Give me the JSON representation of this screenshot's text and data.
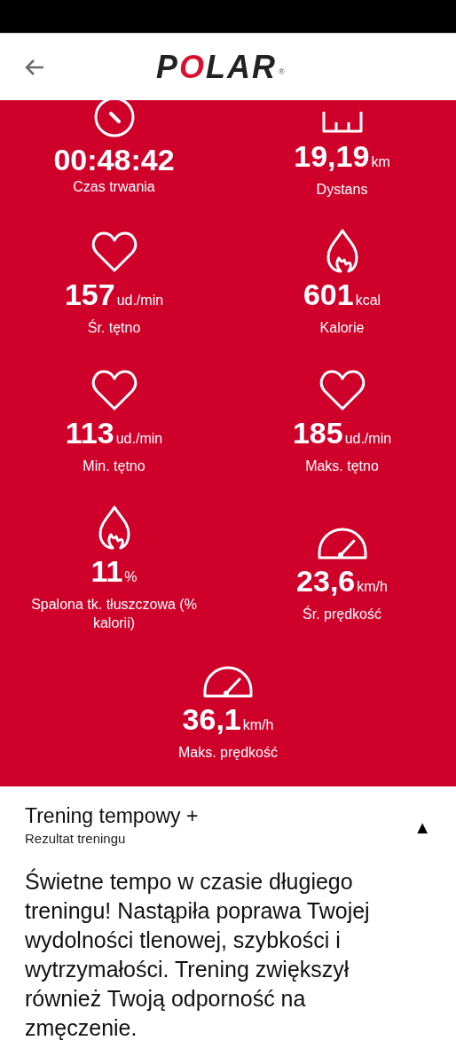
{
  "header": {
    "logo": "POLAR",
    "logo_mark": "®"
  },
  "metrics": [
    {
      "kind": "timer",
      "value": "00:48:42",
      "label": "Czas trwania"
    },
    {
      "kind": "distance",
      "value": "19,19",
      "unit": "km",
      "label": "Dystans"
    },
    {
      "kind": "heart",
      "value": "157",
      "unit": "ud./min",
      "label": "Śr. tętno"
    },
    {
      "kind": "flame",
      "value": "601",
      "unit": "kcal",
      "label": "Kalorie"
    },
    {
      "kind": "heart",
      "value": "113",
      "unit": "ud./min",
      "label": "Min. tętno"
    },
    {
      "kind": "heart",
      "value": "185",
      "unit": "ud./min",
      "label": "Maks. tętno"
    },
    {
      "kind": "flame",
      "value": "11",
      "unit": "%",
      "label": "Spalona tk. tłuszczowa (% kalorii)"
    },
    {
      "kind": "speed",
      "value": "23,6",
      "unit": "km/h",
      "label": "Śr. prędkość"
    },
    {
      "kind": "speed",
      "value": "36,1",
      "unit": "km/h",
      "label": "Maks. prędkość"
    }
  ],
  "result": {
    "title": "Trening tempowy +",
    "subtitle": "Rezultat treningu",
    "toggle": "▲",
    "expanded": true,
    "text": "Świetne tempo w czasie długiego treningu! Nastąpiła poprawa Twojej wydolności tlenowej, szybkości i wytrzymałości. Trening zwiększył również Twoją odporność na zmęczenie."
  }
}
